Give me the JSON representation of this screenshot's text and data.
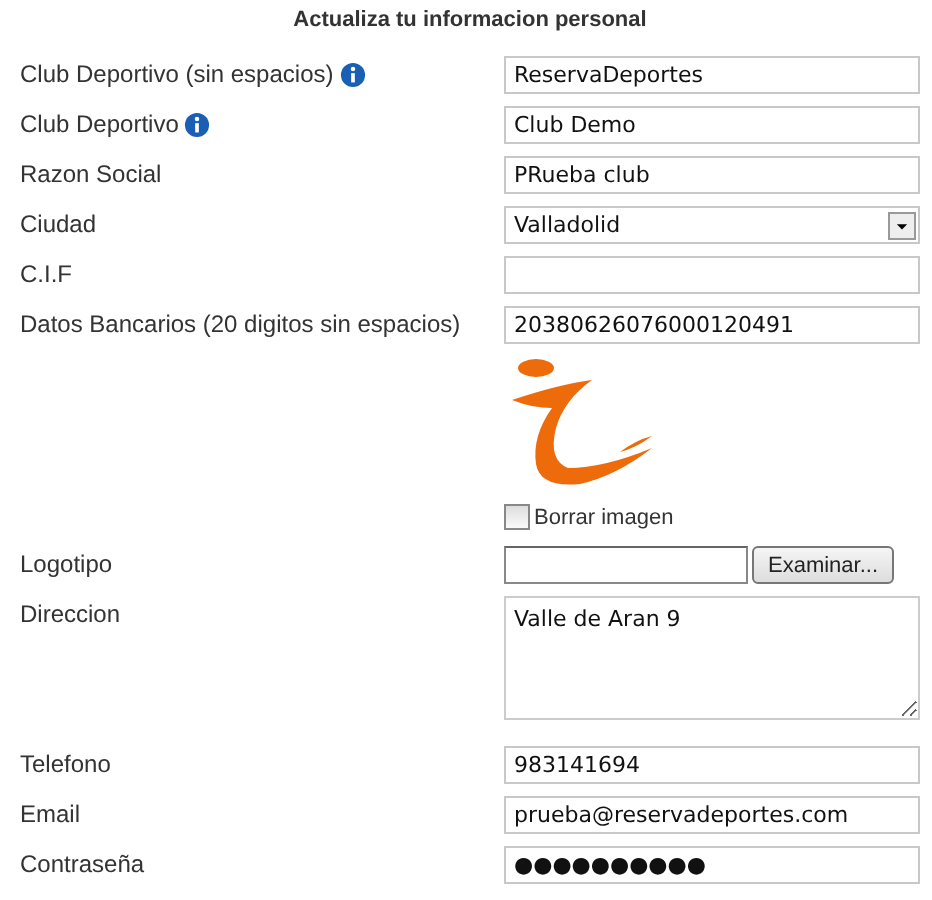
{
  "title": "Actualiza tu informacion personal",
  "fields": [
    {
      "kind": "text",
      "label": "Club Deportivo (sin espacios)",
      "info": true,
      "value": "ReservaDeportes"
    },
    {
      "kind": "text",
      "label": "Club Deportivo",
      "info": true,
      "value": "Club Demo"
    },
    {
      "kind": "text",
      "label": "Razon Social",
      "info": false,
      "value": "PRueba club"
    },
    {
      "kind": "select",
      "label": "Ciudad",
      "info": false,
      "value": "Valladolid"
    },
    {
      "kind": "text",
      "label": "C.I.F",
      "info": false
    },
    {
      "kind": "text",
      "label": "Datos Bancarios (20 digitos sin espacios)",
      "info": false,
      "value": "20380626076000120491"
    },
    {
      "kind": "image",
      "checkbox": {
        "label": "Borrar imagen",
        "checked": false
      }
    },
    {
      "kind": "file",
      "label": "Logotipo",
      "info": false,
      "button": "Examinar..."
    },
    {
      "kind": "textarea",
      "label": "Direccion",
      "info": false,
      "value": "Valle de Aran 9"
    },
    {
      "kind": "text",
      "label": "Telefono",
      "info": false,
      "value": "983141694"
    },
    {
      "kind": "text",
      "label": "Email",
      "info": false,
      "value": "prueba@reservadeportes.com"
    },
    {
      "kind": "text",
      "label": "Contraseña",
      "info": false,
      "value": "●●●●●●●●●●"
    }
  ]
}
